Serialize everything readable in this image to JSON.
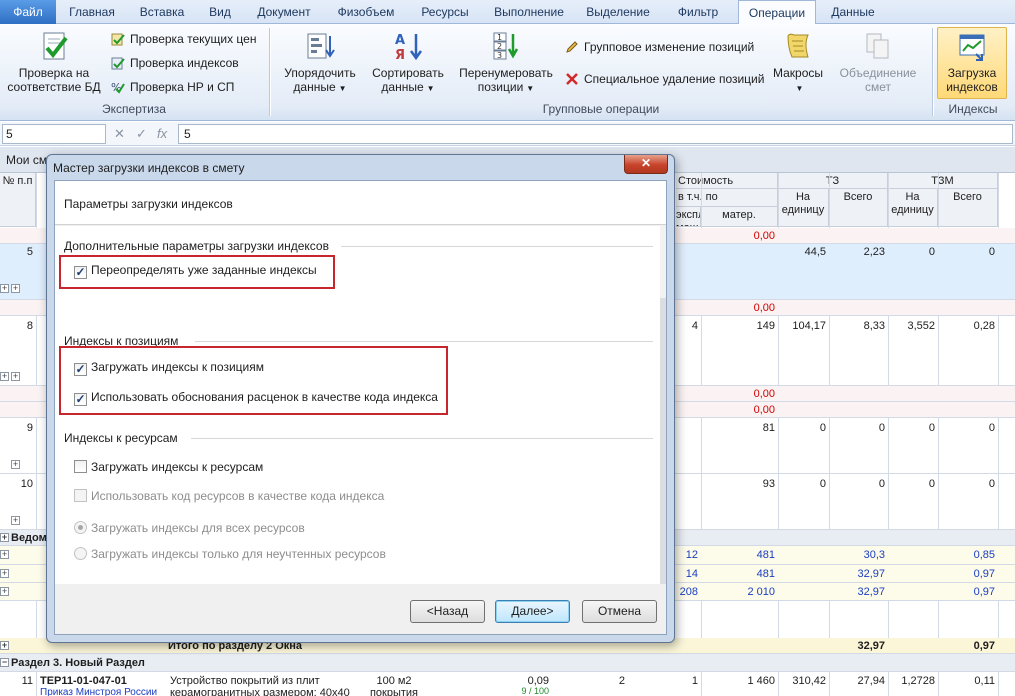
{
  "tabs": [
    {
      "label": "Файл",
      "x": 0
    },
    {
      "label": "Главная"
    },
    {
      "label": "Вставка"
    },
    {
      "label": "Вид"
    },
    {
      "label": "Документ"
    },
    {
      "label": "Физобъем"
    },
    {
      "label": "Ресурсы"
    },
    {
      "label": "Выполнение"
    },
    {
      "label": "Выделение"
    },
    {
      "label": "Фильтр"
    },
    {
      "label": "Операции"
    },
    {
      "label": "Данные"
    }
  ],
  "ribbon": {
    "expertise": {
      "check_db_label": "Проверка на соответствие БД",
      "check_prices": "Проверка текущих цен",
      "check_indexes": "Проверка индексов",
      "check_nr_sp": "Проверка НР и СП",
      "group_label": "Экспертиза"
    },
    "group_ops": {
      "order_label": "Упорядочить данные",
      "sort_label": "Сортировать данные",
      "renumber_label": "Перенумеровать позиции",
      "group_change": "Групповое изменение позиций",
      "special_delete": "Специальное удаление позиций",
      "macros_label": "Макросы",
      "merge_label": "Объединение смет",
      "group_label": "Групповые операции"
    },
    "indexes": {
      "load_label": "Загрузка индексов",
      "group_label": "Индексы"
    }
  },
  "formula_bar": {
    "name_box": "5",
    "cancel_glyph": "✕",
    "confirm_glyph": "✓",
    "fx_glyph": "fx",
    "value": "5"
  },
  "sheet": {
    "tab_label": "Мои сметы",
    "headers": {
      "num": "№ п.п",
      "cost": "Стоимость",
      "incl": "в т.ч. по",
      "mach": "эксплуатации маш.",
      "mat": "матер.",
      "t3": "ТЗ",
      "t3_unit": "На единицу",
      "t3_total": "Всего",
      "t3m": "ТЗМ",
      "t3m_unit": "На единицу",
      "t3m_total": "Всего"
    },
    "rows": {
      "r1_mat": "0,00",
      "r5_num": "5",
      "r5_t3u": "44,5",
      "r5_t3t": "2,23",
      "r5_tzmu": "0",
      "r5_tzmt": "0",
      "r2_mat": "0,00",
      "r8_num": "8",
      "r8_mach": "4",
      "r8_mat": "149",
      "r8_t3u": "104,17",
      "r8_t3t": "8,33",
      "r8_tzmu": "3,552",
      "r8_tzmt": "0,28",
      "r3_mat": "0,00",
      "r4_mat": "0,00",
      "r9_num": "9",
      "r9_mat": "81",
      "r9_t3u": "0",
      "r9_t3t": "0",
      "r9_tzmu": "0",
      "r9_tzmt": "0",
      "r10_num": "10",
      "r10_mat": "93",
      "r10_t3u": "0",
      "r10_t3t": "0",
      "r10_tzmu": "0",
      "r10_tzmt": "0",
      "sec_label": "Ведомость",
      "s1_mach": "12",
      "s1_mat": "481",
      "s1_t3t": "30,3",
      "s1_tzmt": "0,85",
      "s2_mach": "14",
      "s2_mat": "481",
      "s2_t3t": "32,97",
      "s2_tzmt": "0,97",
      "s3_mach": "208",
      "s3_mat": "2 010",
      "s3_t3t": "32,97",
      "s3_tzmt": "0,97",
      "total_label": "Итого по разделу 2 Окна",
      "total_t3t": "32,97",
      "total_tzmt": "0,97",
      "section3_label": "Раздел 3. Новый Раздел",
      "r11_num": "11",
      "r11_code": "ТЕР11-01-047-01",
      "r11_src": "Приказ Минстроя России",
      "r11_name": "Устройство покрытий из плит керамогранитных размером: 40x40",
      "r11_unit": "100 м2 покрытия",
      "r11_qty": "0,09",
      "r11_qty2": "9 / 100",
      "r11_c1": "2",
      "r11_c2": "1",
      "r11_mat": "1 460",
      "r11_t3u": "310,42",
      "r11_t3t": "27,94",
      "r11_tzmu": "1,2728",
      "r11_tzmt": "0,11"
    }
  },
  "dialog": {
    "title": "Мастер загрузки индексов в смету",
    "close_glyph": "✕",
    "header": "Параметры загрузки индексов",
    "group_additional": "Дополнительные параметры загрузки индексов",
    "override_label": "Переопределять уже заданные индексы",
    "group_positions": "Индексы к позициям",
    "load_positions_label": "Загружать индексы к позициям",
    "use_justification_label": "Использовать обоснования расценок в качестве кода индекса",
    "group_resources": "Индексы к ресурсам",
    "load_resources_label": "Загружать индексы к ресурсам",
    "use_resource_code_label": "Использовать код ресурсов в качестве кода индекса",
    "radio_all_label": "Загружать индексы для всех ресурсов",
    "radio_unaccounted_label": "Загружать индексы только для неучтенных ресурсов",
    "check_glyph": "✓",
    "buttons": {
      "back": "<Назад",
      "next": "Далее>",
      "cancel": "Отмена"
    }
  }
}
